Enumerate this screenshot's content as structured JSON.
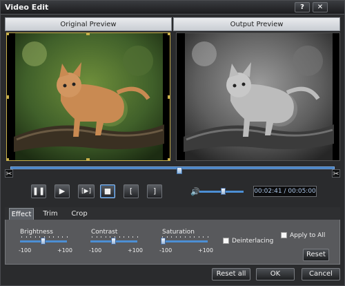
{
  "window": {
    "title": "Video Edit",
    "help_label": "?",
    "close_label": "✕"
  },
  "previews": {
    "original_label": "Original Preview",
    "output_label": "Output Preview"
  },
  "timeline": {
    "position_fraction": 0.52,
    "cut_start_icon": "scissors-icon",
    "cut_end_icon": "scissors-icon"
  },
  "playback": {
    "pause_label": "❚❚",
    "step_label": "▶",
    "frame_label": "[▶]",
    "stop_label": "■",
    "mark_in_label": "[",
    "mark_out_label": "]",
    "volume_icon": "speaker-icon",
    "volume_fraction": 0.55,
    "time": "00:02:41 / 00:05:00"
  },
  "effects": {
    "tabs": [
      "Effect",
      "Trim",
      "Crop"
    ],
    "active_tab": "Effect",
    "brightness": {
      "label": "Brightness",
      "min": "-100",
      "max": "+100",
      "value": 0
    },
    "contrast": {
      "label": "Contrast",
      "min": "-100",
      "max": "+100",
      "value": 0
    },
    "saturation": {
      "label": "Saturation",
      "min": "-100",
      "max": "+100",
      "value": -100
    },
    "deinterlacing_label": "Deinterlacing",
    "deinterlacing_checked": false,
    "apply_all_label": "Apply to All",
    "apply_all_checked": false,
    "reset_label": "Reset"
  },
  "footer": {
    "reset_all_label": "Reset all",
    "ok_label": "OK",
    "cancel_label": "Cancel"
  }
}
